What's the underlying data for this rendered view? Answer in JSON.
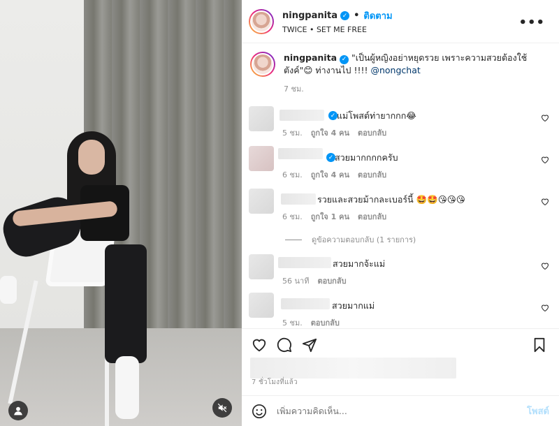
{
  "post": {
    "author": "ningpanita",
    "follow_label": "ติดตาม",
    "audio": "TWICE • SET ME FREE",
    "more": "•••"
  },
  "caption": {
    "username": "ningpanita",
    "text": " \"เป็นผู้หญิงอย่าหยุดรวย เพราะความสวยต้องใช้ตังค์\"😊 ท่างานไป !!!! ",
    "mention": "@nongchat",
    "time": "7 ชม."
  },
  "comments": [
    {
      "text": "แม่โพสต์ท่ายากกก😂",
      "time": "5 ชม.",
      "likes": "ถูกใจ 4 คน",
      "reply": "ตอบกลับ",
      "verified": true
    },
    {
      "text": "สวยมากกกกครับ",
      "time": "6 ชม.",
      "likes": "ถูกใจ 4 คน",
      "reply": "ตอบกลับ",
      "verified": true
    },
    {
      "text": "รวยและสวยม้ากละเบอร์นี้ 🤩🤩😘😘😘",
      "time": "6 ชม.",
      "likes": "ถูกใจ 1 คน",
      "reply": "ตอบกลับ",
      "verified": false
    },
    {
      "text": "สวยมากจ้ะแม่",
      "time": "56 นาที",
      "likes": "",
      "reply": "ตอบกลับ",
      "verified": false
    },
    {
      "text": "สวยมากแม่",
      "time": "5 ชม.",
      "likes": "",
      "reply": "ตอบกลับ",
      "verified": false
    }
  ],
  "view_replies": "ดูข้อความตอบกลับ (1 รายการ)",
  "time_ago": "7 ชั่วโมงที่แล้ว",
  "add_comment": {
    "placeholder": "เพิ่มความคิดเห็น...",
    "post_label": "โพสต์"
  },
  "colors": {
    "accent": "#0095f6",
    "muted": "#8e8e8e",
    "post_disabled": "#b2dffc"
  },
  "icons": [
    "user-tag-icon",
    "mute-icon",
    "heart-icon",
    "comment-icon",
    "share-icon",
    "bookmark-icon",
    "emoji-icon",
    "verified-icon"
  ]
}
